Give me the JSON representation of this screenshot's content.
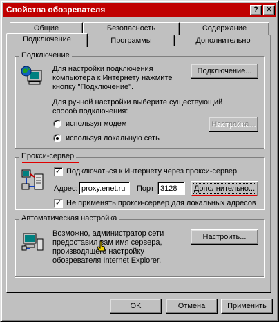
{
  "window": {
    "title": "Свойства обозревателя",
    "help_btn": "?",
    "close_btn": "✕"
  },
  "tabs": {
    "row1": [
      "Общие",
      "Безопасность",
      "Содержание"
    ],
    "row2": [
      "Подключение",
      "Программы",
      "Дополнительно"
    ],
    "active": "Подключение"
  },
  "connection": {
    "legend": "Подключение",
    "setup_text": [
      "Для настройки подключения",
      "компьютера к Интернету нажмите",
      "кнопку \"Подключение\"."
    ],
    "connect_button": "Подключение...",
    "manual_text": [
      "Для ручной настройки выберите существующий",
      "способ подключения:"
    ],
    "radio_modem": "используя модем",
    "radio_lan": "используя локальную сеть",
    "settings_button": "Настройка..."
  },
  "proxy": {
    "legend": "Прокси-сервер",
    "use_proxy": "Подключаться к Интернету через прокси-сервер",
    "address_label": "Адрес:",
    "address_value": "proxy.enet.ru",
    "port_label": "Порт:",
    "port_value": "3128",
    "advanced_button": "Дополнительно...",
    "bypass_local": "Не применять прокси-сервер для локальных адресов"
  },
  "auto": {
    "legend": "Автоматическая настройка",
    "text": [
      "Возможно, администратор сети",
      "предоставил вам имя сервера,",
      "производящего настройку",
      "обозревателя Internet Explorer."
    ],
    "settings_button": "Настроить..."
  },
  "footer": {
    "ok": "OK",
    "cancel": "Отмена",
    "apply": "Применить"
  },
  "colors": {
    "titlebar": "#c00000",
    "annotation": "#e00000"
  }
}
